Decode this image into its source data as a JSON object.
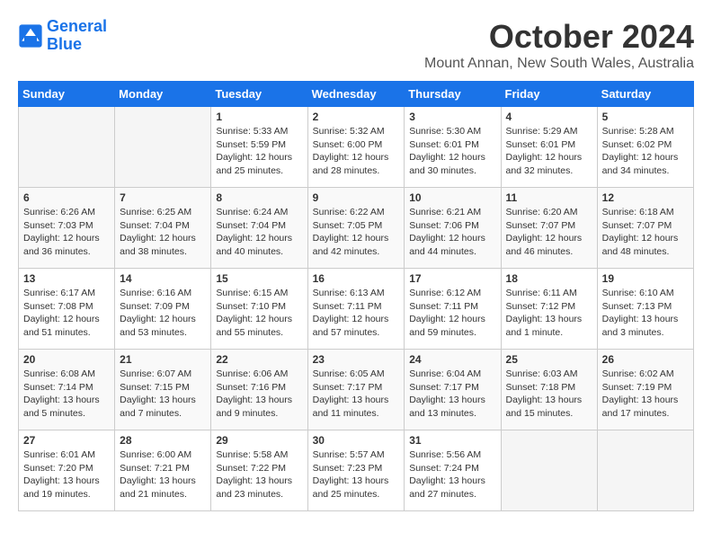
{
  "header": {
    "logo_general": "General",
    "logo_blue": "Blue",
    "month": "October 2024",
    "location": "Mount Annan, New South Wales, Australia"
  },
  "days_of_week": [
    "Sunday",
    "Monday",
    "Tuesday",
    "Wednesday",
    "Thursday",
    "Friday",
    "Saturday"
  ],
  "weeks": [
    [
      {
        "day": "",
        "empty": true
      },
      {
        "day": "",
        "empty": true
      },
      {
        "day": "1",
        "sunrise": "Sunrise: 5:33 AM",
        "sunset": "Sunset: 5:59 PM",
        "daylight": "Daylight: 12 hours and 25 minutes."
      },
      {
        "day": "2",
        "sunrise": "Sunrise: 5:32 AM",
        "sunset": "Sunset: 6:00 PM",
        "daylight": "Daylight: 12 hours and 28 minutes."
      },
      {
        "day": "3",
        "sunrise": "Sunrise: 5:30 AM",
        "sunset": "Sunset: 6:01 PM",
        "daylight": "Daylight: 12 hours and 30 minutes."
      },
      {
        "day": "4",
        "sunrise": "Sunrise: 5:29 AM",
        "sunset": "Sunset: 6:01 PM",
        "daylight": "Daylight: 12 hours and 32 minutes."
      },
      {
        "day": "5",
        "sunrise": "Sunrise: 5:28 AM",
        "sunset": "Sunset: 6:02 PM",
        "daylight": "Daylight: 12 hours and 34 minutes."
      }
    ],
    [
      {
        "day": "6",
        "sunrise": "Sunrise: 6:26 AM",
        "sunset": "Sunset: 7:03 PM",
        "daylight": "Daylight: 12 hours and 36 minutes."
      },
      {
        "day": "7",
        "sunrise": "Sunrise: 6:25 AM",
        "sunset": "Sunset: 7:04 PM",
        "daylight": "Daylight: 12 hours and 38 minutes."
      },
      {
        "day": "8",
        "sunrise": "Sunrise: 6:24 AM",
        "sunset": "Sunset: 7:04 PM",
        "daylight": "Daylight: 12 hours and 40 minutes."
      },
      {
        "day": "9",
        "sunrise": "Sunrise: 6:22 AM",
        "sunset": "Sunset: 7:05 PM",
        "daylight": "Daylight: 12 hours and 42 minutes."
      },
      {
        "day": "10",
        "sunrise": "Sunrise: 6:21 AM",
        "sunset": "Sunset: 7:06 PM",
        "daylight": "Daylight: 12 hours and 44 minutes."
      },
      {
        "day": "11",
        "sunrise": "Sunrise: 6:20 AM",
        "sunset": "Sunset: 7:07 PM",
        "daylight": "Daylight: 12 hours and 46 minutes."
      },
      {
        "day": "12",
        "sunrise": "Sunrise: 6:18 AM",
        "sunset": "Sunset: 7:07 PM",
        "daylight": "Daylight: 12 hours and 48 minutes."
      }
    ],
    [
      {
        "day": "13",
        "sunrise": "Sunrise: 6:17 AM",
        "sunset": "Sunset: 7:08 PM",
        "daylight": "Daylight: 12 hours and 51 minutes."
      },
      {
        "day": "14",
        "sunrise": "Sunrise: 6:16 AM",
        "sunset": "Sunset: 7:09 PM",
        "daylight": "Daylight: 12 hours and 53 minutes."
      },
      {
        "day": "15",
        "sunrise": "Sunrise: 6:15 AM",
        "sunset": "Sunset: 7:10 PM",
        "daylight": "Daylight: 12 hours and 55 minutes."
      },
      {
        "day": "16",
        "sunrise": "Sunrise: 6:13 AM",
        "sunset": "Sunset: 7:11 PM",
        "daylight": "Daylight: 12 hours and 57 minutes."
      },
      {
        "day": "17",
        "sunrise": "Sunrise: 6:12 AM",
        "sunset": "Sunset: 7:11 PM",
        "daylight": "Daylight: 12 hours and 59 minutes."
      },
      {
        "day": "18",
        "sunrise": "Sunrise: 6:11 AM",
        "sunset": "Sunset: 7:12 PM",
        "daylight": "Daylight: 13 hours and 1 minute."
      },
      {
        "day": "19",
        "sunrise": "Sunrise: 6:10 AM",
        "sunset": "Sunset: 7:13 PM",
        "daylight": "Daylight: 13 hours and 3 minutes."
      }
    ],
    [
      {
        "day": "20",
        "sunrise": "Sunrise: 6:08 AM",
        "sunset": "Sunset: 7:14 PM",
        "daylight": "Daylight: 13 hours and 5 minutes."
      },
      {
        "day": "21",
        "sunrise": "Sunrise: 6:07 AM",
        "sunset": "Sunset: 7:15 PM",
        "daylight": "Daylight: 13 hours and 7 minutes."
      },
      {
        "day": "22",
        "sunrise": "Sunrise: 6:06 AM",
        "sunset": "Sunset: 7:16 PM",
        "daylight": "Daylight: 13 hours and 9 minutes."
      },
      {
        "day": "23",
        "sunrise": "Sunrise: 6:05 AM",
        "sunset": "Sunset: 7:17 PM",
        "daylight": "Daylight: 13 hours and 11 minutes."
      },
      {
        "day": "24",
        "sunrise": "Sunrise: 6:04 AM",
        "sunset": "Sunset: 7:17 PM",
        "daylight": "Daylight: 13 hours and 13 minutes."
      },
      {
        "day": "25",
        "sunrise": "Sunrise: 6:03 AM",
        "sunset": "Sunset: 7:18 PM",
        "daylight": "Daylight: 13 hours and 15 minutes."
      },
      {
        "day": "26",
        "sunrise": "Sunrise: 6:02 AM",
        "sunset": "Sunset: 7:19 PM",
        "daylight": "Daylight: 13 hours and 17 minutes."
      }
    ],
    [
      {
        "day": "27",
        "sunrise": "Sunrise: 6:01 AM",
        "sunset": "Sunset: 7:20 PM",
        "daylight": "Daylight: 13 hours and 19 minutes."
      },
      {
        "day": "28",
        "sunrise": "Sunrise: 6:00 AM",
        "sunset": "Sunset: 7:21 PM",
        "daylight": "Daylight: 13 hours and 21 minutes."
      },
      {
        "day": "29",
        "sunrise": "Sunrise: 5:58 AM",
        "sunset": "Sunset: 7:22 PM",
        "daylight": "Daylight: 13 hours and 23 minutes."
      },
      {
        "day": "30",
        "sunrise": "Sunrise: 5:57 AM",
        "sunset": "Sunset: 7:23 PM",
        "daylight": "Daylight: 13 hours and 25 minutes."
      },
      {
        "day": "31",
        "sunrise": "Sunrise: 5:56 AM",
        "sunset": "Sunset: 7:24 PM",
        "daylight": "Daylight: 13 hours and 27 minutes."
      },
      {
        "day": "",
        "empty": true
      },
      {
        "day": "",
        "empty": true
      }
    ]
  ]
}
